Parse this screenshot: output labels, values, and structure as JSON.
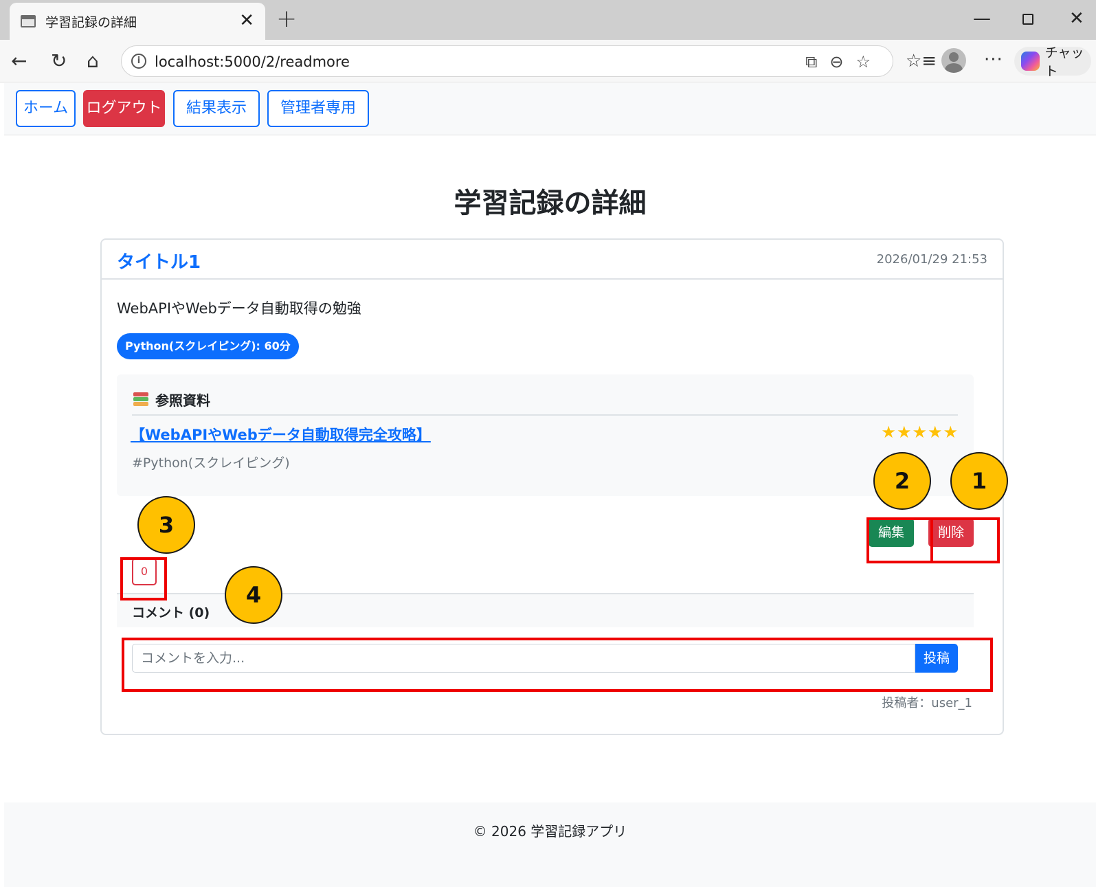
{
  "browser": {
    "tab_title": "学習記録の詳細",
    "tab_close": "✕",
    "new_tab": "+",
    "url": "localhost:5000/2/readmore",
    "chat_label": "チャット",
    "window_buttons": {
      "minimize": "—",
      "close": "✕"
    },
    "nav_icons": {
      "back": "←",
      "reload": "↻",
      "home": "⌂"
    },
    "more": "···",
    "favorites": "☆≡",
    "address_icons": "⧉⊖☆",
    "info_icon": "i"
  },
  "navbar": {
    "home": "ホーム",
    "logout": "ログアウト",
    "results": "結果表示",
    "admin": "管理者専用"
  },
  "page": {
    "title": "学習記録の詳細"
  },
  "record": {
    "title": "タイトル1",
    "date": "2026/01/29 21:53",
    "description": "WebAPIやWebデータ自動取得の勉強",
    "badge": "Python(スクレイピング): 60分",
    "reference": {
      "heading": "参照資料",
      "link": "【WebAPIやWebデータ自動取得完全攻略】",
      "stars": "★★★★★",
      "rating": 5,
      "tag": "#Python(スクレイピング)"
    },
    "actions": {
      "edit": "編集",
      "delete": "削除"
    },
    "likes": "0",
    "comments": {
      "header": "コメント (0)",
      "placeholder": "コメントを入力...",
      "submit": "投稿"
    },
    "author": "投稿者：user_1"
  },
  "footer": {
    "text": "© 2026 学習記録アプリ"
  },
  "annotations": {
    "markers": [
      "1",
      "2",
      "3",
      "4"
    ]
  },
  "colors": {
    "primary": "#0d6efd",
    "danger": "#dc3545",
    "success": "#198754",
    "star": "#ffc107",
    "marker": "#ffc000",
    "highlight": "#ee0000"
  }
}
